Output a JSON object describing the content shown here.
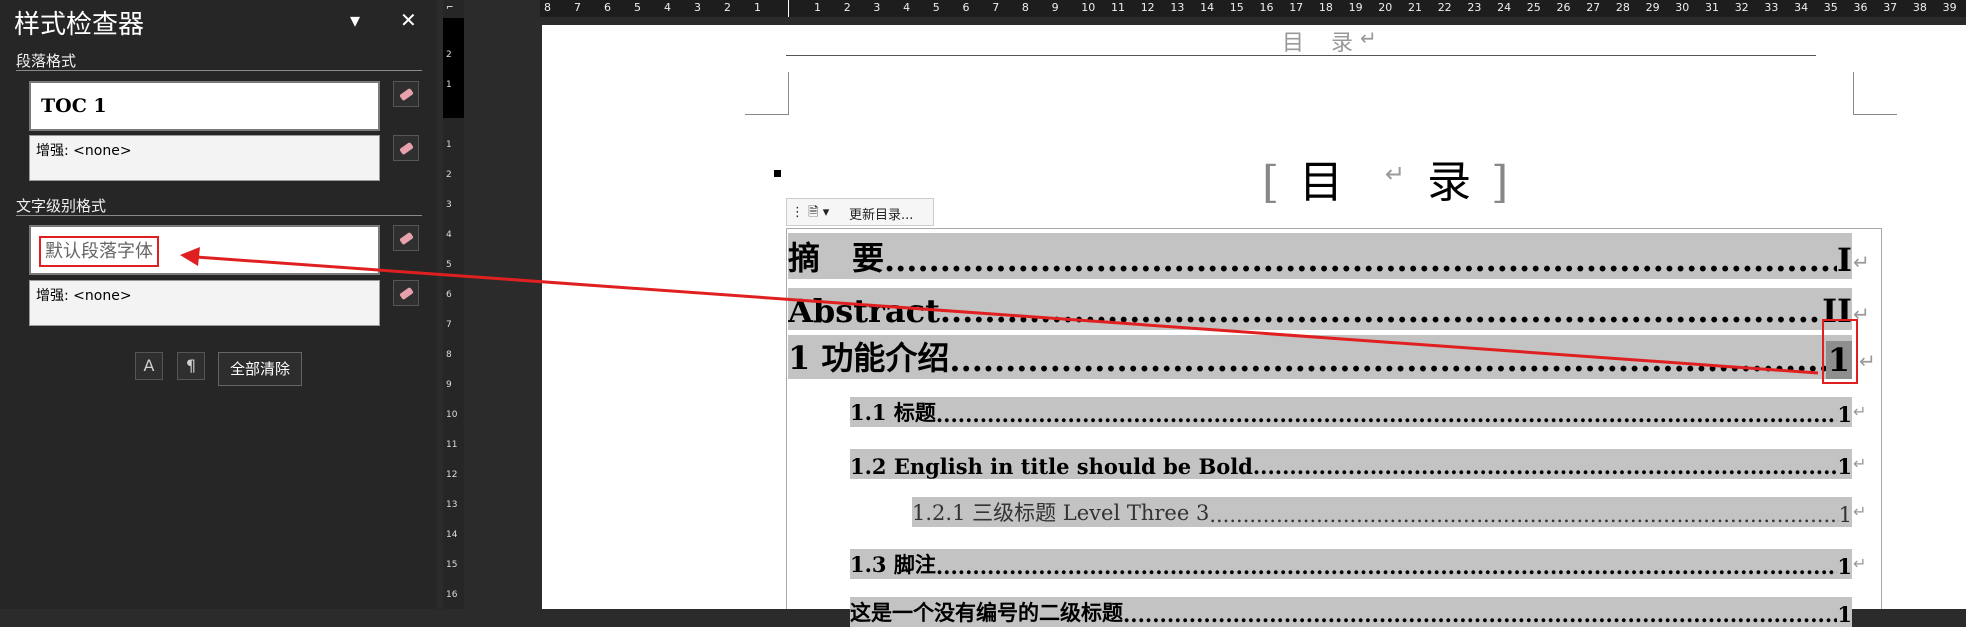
{
  "panel": {
    "title": "样式检查器",
    "paragraph_section": "段落格式",
    "paragraph_style": "TOC 1",
    "paragraph_enhance": "增强: <none>",
    "char_section": "文字级别格式",
    "char_style": "默认段落字体",
    "char_enhance": "增强: <none>",
    "clear_all": "全部清除"
  },
  "ruler": {
    "h_left": [
      "8",
      "7",
      "6",
      "5",
      "4",
      "3",
      "2",
      "1"
    ],
    "h_right": [
      "1",
      "2",
      "3",
      "4",
      "5",
      "6",
      "7",
      "8",
      "9",
      "10",
      "11",
      "12",
      "13",
      "14",
      "15",
      "16",
      "17",
      "18",
      "19",
      "20",
      "21",
      "22",
      "23",
      "24",
      "25",
      "26",
      "27",
      "28",
      "29",
      "30",
      "31",
      "32",
      "33",
      "34",
      "35",
      "36",
      "37",
      "38",
      "39"
    ],
    "v": [
      "2",
      "1",
      "1",
      "2",
      "3",
      "4",
      "5",
      "6",
      "7",
      "8",
      "9",
      "10",
      "11",
      "12",
      "13",
      "14",
      "15",
      "16"
    ]
  },
  "document": {
    "header_text": "目 录",
    "toc_title": "目　录",
    "toc_toolbar_update": "更新目录...",
    "entries": [
      {
        "text": "摘　要",
        "page": "I"
      },
      {
        "text": "Abstract",
        "page": "II"
      },
      {
        "text": "1 功能介绍",
        "page": "1"
      },
      {
        "text": "1.1 标题",
        "page": "1"
      },
      {
        "text": "1.2 English in title should be Bold",
        "page": "1"
      },
      {
        "text": "1.2.1 三级标题 Level Three 3",
        "page": "1"
      },
      {
        "text": "1.3 脚注",
        "page": "1"
      },
      {
        "text": "这是一个没有编号的二级标题",
        "page": "1"
      }
    ]
  },
  "colors": {
    "annotation": "#e02020",
    "highlight": "#c3c3c3"
  }
}
